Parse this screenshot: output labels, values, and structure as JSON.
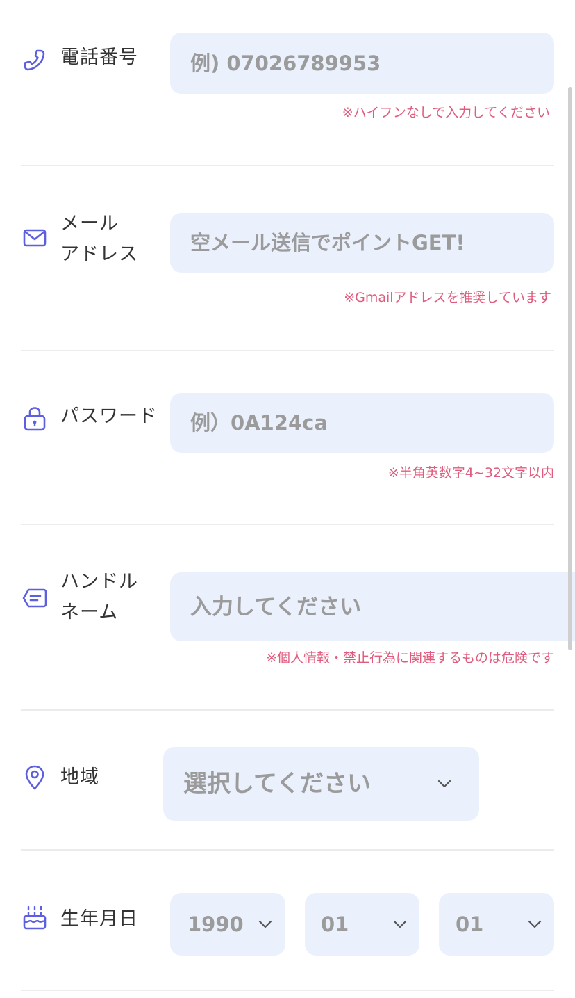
{
  "form": {
    "phone": {
      "icon": "phone-icon",
      "label": "電話番号",
      "placeholder": "例) 07026789953",
      "hint": "※ハイフンなしで入力してください"
    },
    "email": {
      "icon": "mail-icon",
      "label_line1": "メール",
      "label_line2": "アドレス",
      "placeholder": "空メール送信でポイントGET!",
      "hint": "※Gmailアドレスを推奨しています"
    },
    "password": {
      "icon": "lock-icon",
      "label": "パスワード",
      "placeholder": "例）0A124ca",
      "hint": "※半角英数字4~32文字以内"
    },
    "handle": {
      "icon": "name-tag-icon",
      "label_line1": "ハンドル",
      "label_line2": "ネーム",
      "placeholder": "入力してください",
      "hint": "※個人情報・禁止行為に関連するものは危険です"
    },
    "region": {
      "icon": "location-pin-icon",
      "label": "地域",
      "selected": "選択してください"
    },
    "birthday": {
      "icon": "birthday-cake-icon",
      "label": "生年月日",
      "year": "1990",
      "month": "01",
      "day": "01"
    }
  },
  "colors": {
    "accent": "#5b5fe0",
    "field_bg": "#ebf1fc",
    "placeholder": "#9b9b9b",
    "hint": "#e05c7e",
    "separator": "#ececec"
  }
}
